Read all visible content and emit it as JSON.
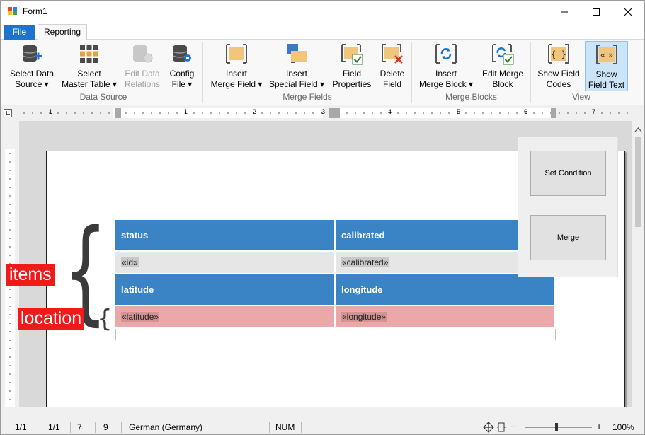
{
  "window": {
    "title": "Form1"
  },
  "tabs": {
    "file": "File",
    "reporting": "Reporting"
  },
  "ribbon": {
    "data_source": {
      "group_label": "Data Source",
      "buttons": [
        {
          "line1": "Select Data",
          "line2": "Source ▾",
          "icon": "database-add-icon"
        },
        {
          "line1": "Select",
          "line2": "Master Table ▾",
          "icon": "grid-icon"
        },
        {
          "line1": "Edit Data",
          "line2": "Relations",
          "icon": "database-relations-icon",
          "disabled": true
        },
        {
          "line1": "Config",
          "line2": "File ▾",
          "icon": "database-config-icon"
        }
      ]
    },
    "merge_fields": {
      "group_label": "Merge Fields",
      "buttons": [
        {
          "line1": "Insert",
          "line2": "Merge Field ▾",
          "icon": "insert-merge-field-icon"
        },
        {
          "line1": "Insert",
          "line2": "Special Field ▾",
          "icon": "special-field-icon"
        },
        {
          "line1": "Field",
          "line2": "Properties",
          "icon": "field-properties-icon"
        },
        {
          "line1": "Delete",
          "line2": "Field",
          "icon": "delete-field-icon"
        }
      ]
    },
    "merge_blocks": {
      "group_label": "Merge Blocks",
      "buttons": [
        {
          "line1": "Insert",
          "line2": "Merge Block ▾",
          "icon": "insert-merge-block-icon"
        },
        {
          "line1": "Edit Merge",
          "line2": "Block",
          "icon": "edit-merge-block-icon"
        }
      ]
    },
    "view": {
      "group_label": "View",
      "buttons": [
        {
          "line1": "Show Field",
          "line2": "Codes",
          "icon": "field-codes-icon"
        },
        {
          "line1": "Show",
          "line2": "Field Text",
          "icon": "field-text-icon",
          "active": true
        }
      ]
    }
  },
  "ruler": {
    "numbers": [
      "1",
      "1",
      "2",
      "3",
      "4",
      "5",
      "6",
      "7"
    ]
  },
  "document": {
    "table": {
      "header1": [
        "status",
        "calibrated"
      ],
      "row1": [
        "«id»",
        "«calibrated»"
      ],
      "header2": [
        "latitude",
        "longitude"
      ],
      "row2": [
        "«latitude»",
        "«longitude»"
      ]
    },
    "annotations": {
      "items": "items",
      "location": "location"
    }
  },
  "panel": {
    "set_condition": "Set Condition",
    "merge": "Merge"
  },
  "status": {
    "page": "1/1",
    "section": "1/1",
    "line": "7",
    "column": "9",
    "language": "German (Germany)",
    "num": "NUM",
    "zoom": "100%",
    "zoom_minus": "−",
    "zoom_plus": "+"
  },
  "colors": {
    "header_blue": "#3a84c6",
    "row_gray": "#e6e6e6",
    "row_red": "#eaa8a8",
    "label_red": "#ef1b1b",
    "file_tab": "#1e74cc"
  }
}
